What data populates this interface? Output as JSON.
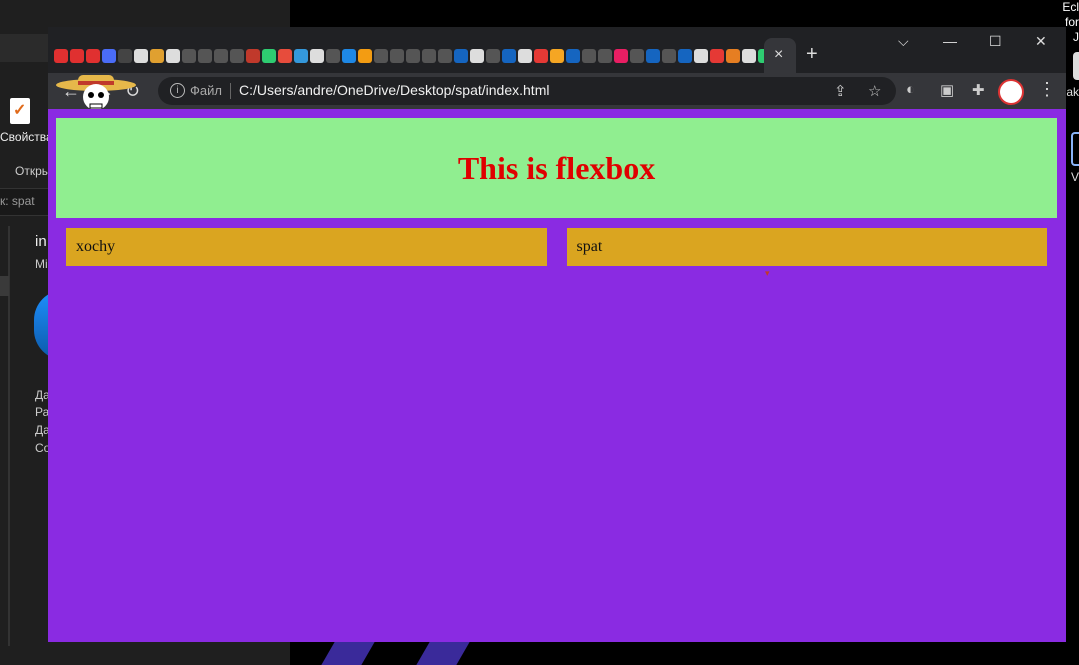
{
  "explorer": {
    "properties_label": "Свойства",
    "open_label": "Откры",
    "search_text": "к: spat",
    "name_title": "in",
    "name_sub": "Mi",
    "meta_lines": [
      "Да",
      "Ра",
      "Да",
      "Со"
    ]
  },
  "desktop_right": {
    "top_line1": "Ecl",
    "top_line2": "for J",
    "mak_label": "ak",
    "v_label": "V"
  },
  "browser": {
    "tab_close": "×",
    "new_tab": "+",
    "window_controls": {
      "dropdown": "⌵",
      "minimize": "—",
      "maximize": "☐",
      "close": "✕"
    },
    "file_label": "Файл",
    "url": "C:/Users/andre/OneDrive/Desktop/spat/index.html",
    "favicon_colors": [
      "#e03030",
      "#e03030",
      "#e03030",
      "#4a6cf7",
      "#444",
      "#ddd",
      "#e0a030",
      "#ddd",
      "#555",
      "#555",
      "#555",
      "#555",
      "#c0392b",
      "#2ecc71",
      "#e74c3c",
      "#3498db",
      "#ddd",
      "#555",
      "#1e88e5",
      "#f39c12",
      "#555",
      "#555",
      "#555",
      "#555",
      "#555",
      "#1565c0",
      "#ddd",
      "#555",
      "#1565c0",
      "#ddd",
      "#e53935",
      "#f5a623",
      "#1565c0",
      "#555",
      "#555",
      "#e91e63",
      "#555",
      "#1565c0",
      "#555",
      "#1565c0",
      "#ddd",
      "#e53935",
      "#e67e22",
      "#ddd",
      "#2ecc71",
      "#555"
    ]
  },
  "page": {
    "heading": "This is flexbox",
    "items": [
      {
        "label": "xochy"
      },
      {
        "label": "spat"
      }
    ]
  },
  "colors": {
    "page_bg": "#8a2be2",
    "header_bg": "#90ee90",
    "heading_color": "#e00000",
    "item_bg": "#daa520"
  }
}
